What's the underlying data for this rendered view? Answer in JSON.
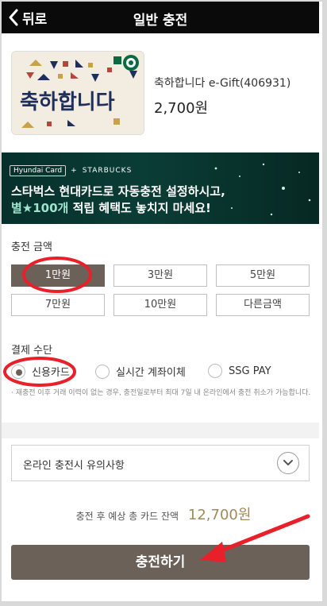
{
  "header": {
    "back_label": "뒤로",
    "title": "일반 충전"
  },
  "gift": {
    "name": "축하합니다 e-Gift(406931)",
    "price": "2,700원",
    "card_art_text": "축하합니다"
  },
  "banner": {
    "brand_left": "Hyundai Card",
    "brand_plus": "+",
    "brand_right": "STARBUCKS",
    "line1": "스타벅스 현대카드로 자동충전 설정하시고,",
    "line2_highlight": "별★100개",
    "line2_rest": " 적립 혜택도 놓치지 마세요!"
  },
  "amount": {
    "label": "충전 금액",
    "options": [
      "1만원",
      "3만원",
      "5만원",
      "7만원",
      "10만원",
      "다른금액"
    ],
    "selected": "1만원"
  },
  "payment": {
    "label": "결제 수단",
    "options": [
      "신용카드",
      "실시간 계좌이체",
      "SSG PAY"
    ],
    "selected": "신용카드",
    "notice": "· 재충전 이후 거래 이력이 없는 경우, 충전일로부터 최대 7일 내 온라인에서 충전 취소가 가능합니다."
  },
  "accordion": {
    "label": "온라인 충전시 유의사항"
  },
  "balance": {
    "label": "충전 후 예상 총 카드 잔액",
    "amount": "12,700원"
  },
  "cta": {
    "label": "충전하기"
  },
  "colors": {
    "accent": "#6b6159",
    "balance_gold": "#a0895d",
    "annotation_red": "#e8202a",
    "banner_bg": "#0a3d36"
  },
  "icons": {
    "back": "chevron-left-icon",
    "expand": "chevron-down-icon",
    "brand": "starbucks-logo-icon"
  }
}
